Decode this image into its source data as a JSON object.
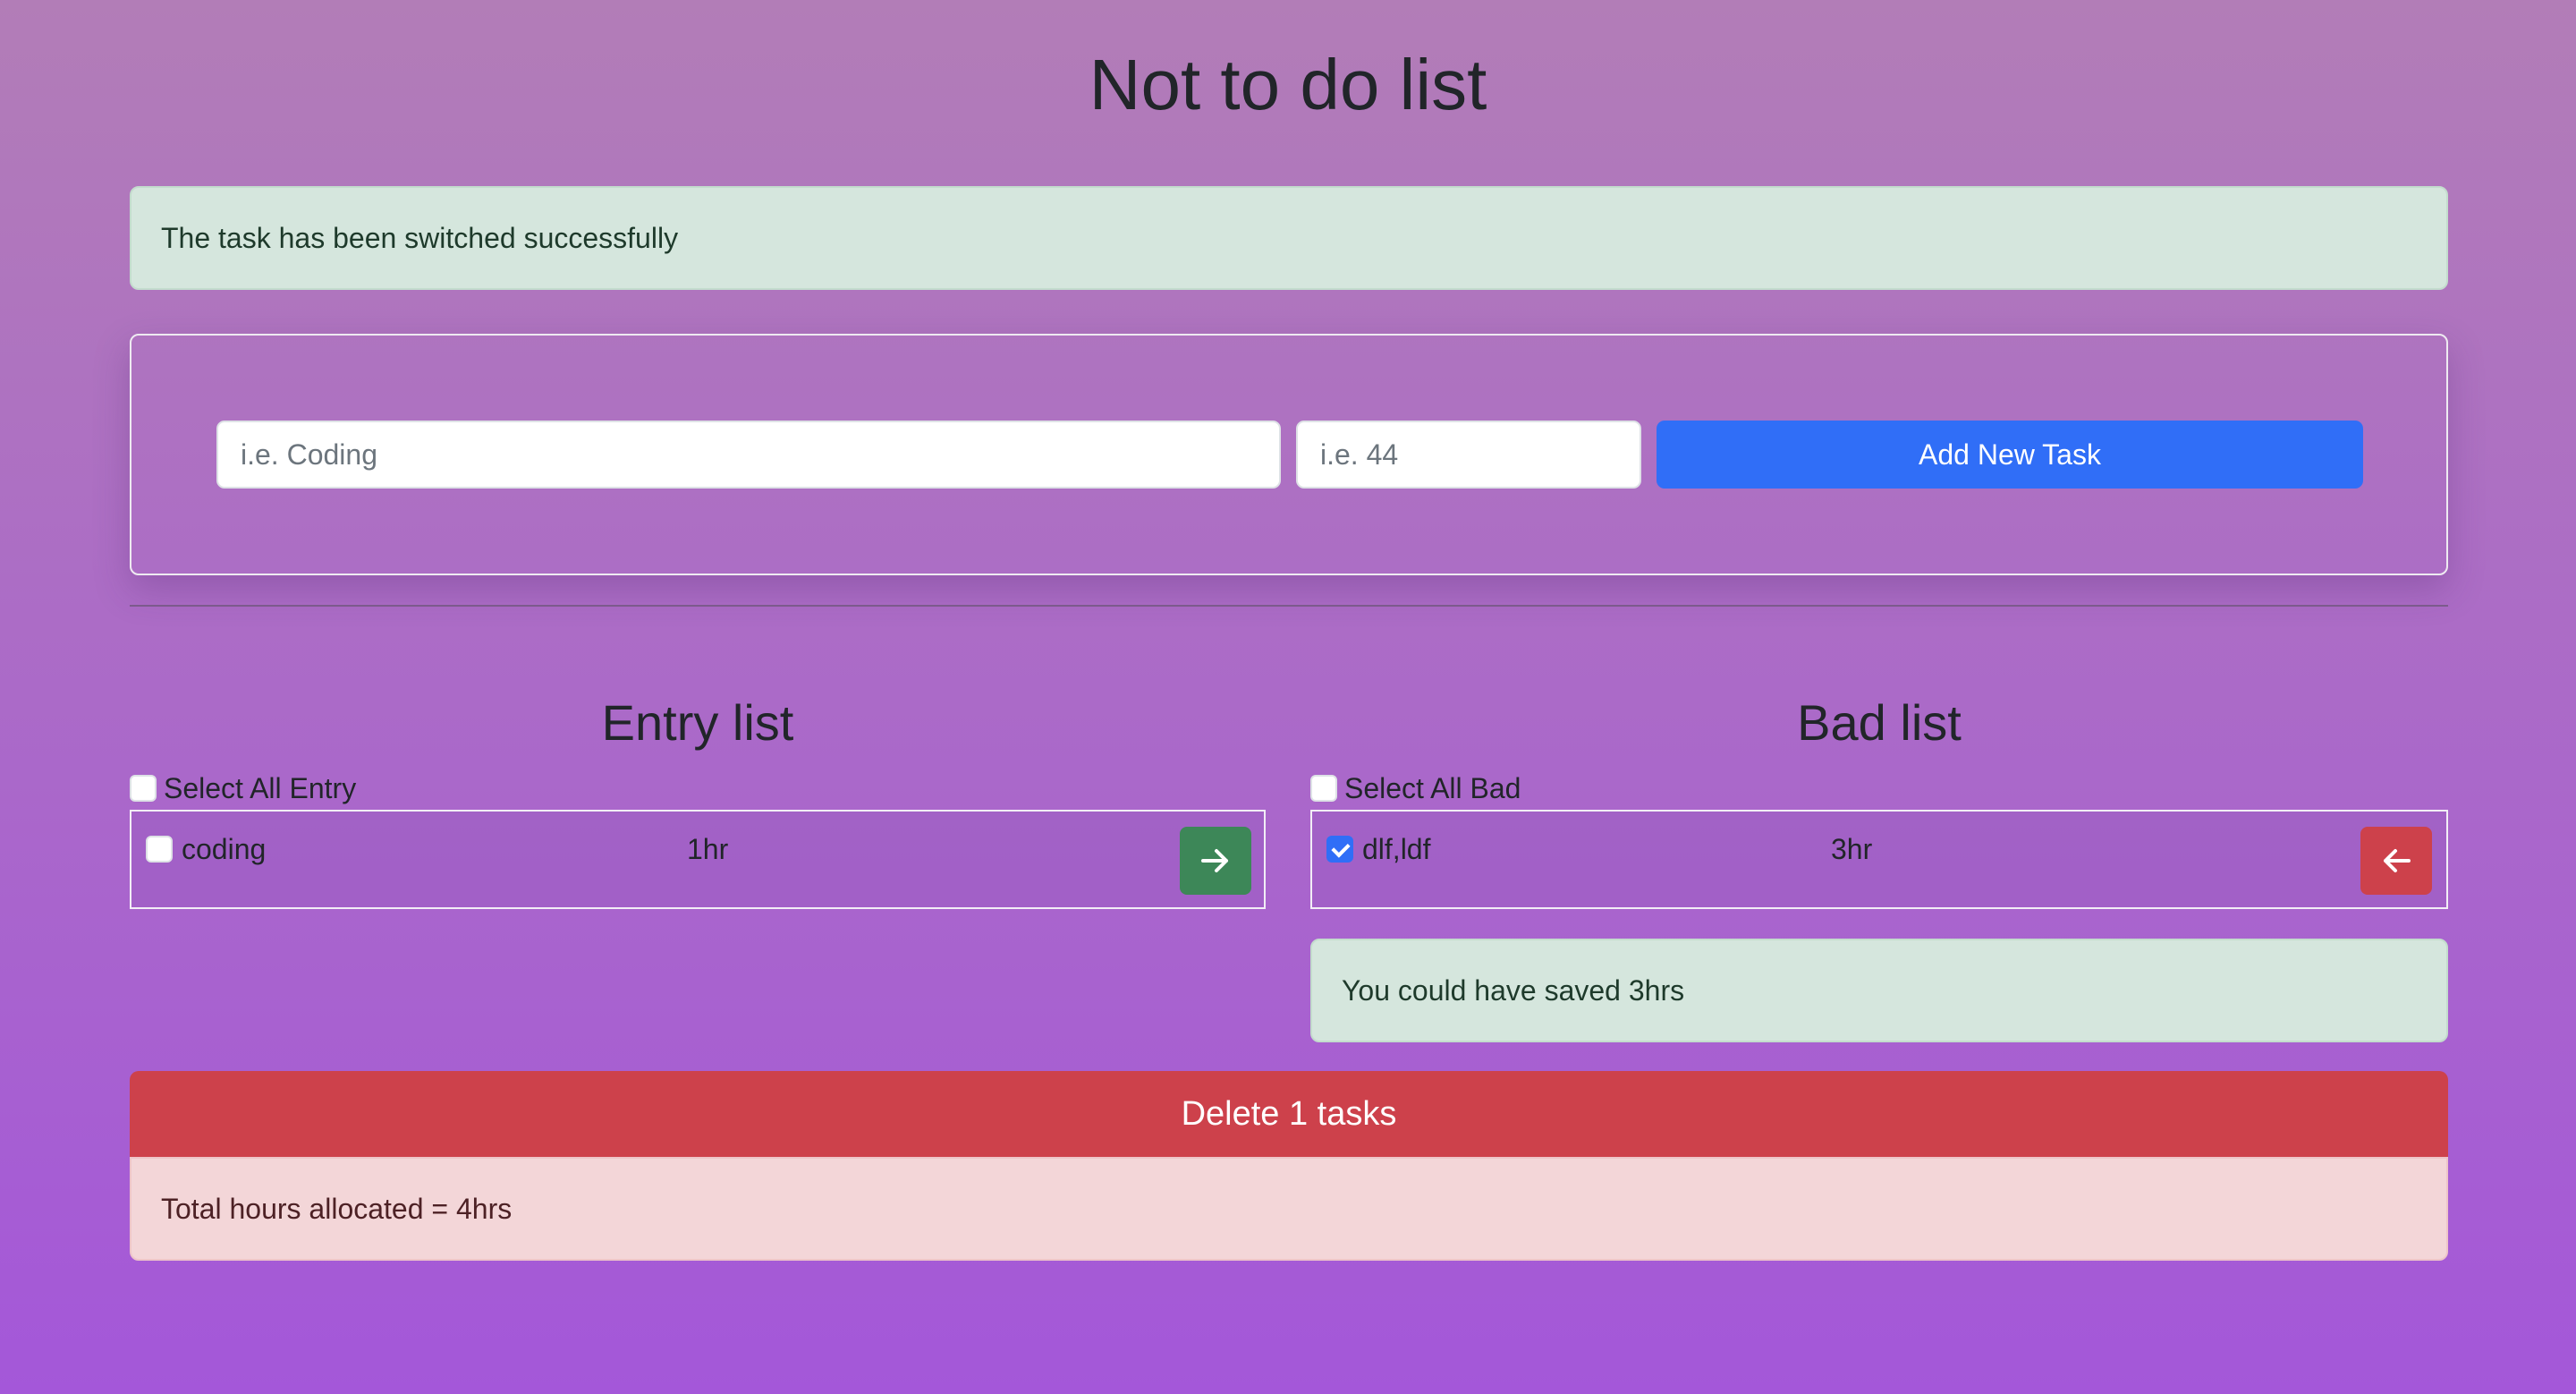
{
  "app": {
    "title": "Not to do list"
  },
  "status_message": "The task has been switched successfully",
  "form": {
    "task_placeholder": "i.e. Coding",
    "hours_placeholder": "i.e. 44",
    "submit_label": "Add New Task"
  },
  "entry_list": {
    "title": "Entry list",
    "select_all_label": "Select All Entry",
    "items": [
      {
        "name": "coding",
        "hours": "1hr",
        "checked": false
      }
    ]
  },
  "bad_list": {
    "title": "Bad list",
    "select_all_label": "Select All Bad",
    "items": [
      {
        "name": "dlf,ldf",
        "hours": "3hr",
        "checked": true
      }
    ],
    "saved_message": "You could have saved 3hrs"
  },
  "delete_button_label": "Delete 1 tasks",
  "total_hours_message": "Total hours allocated = 4hrs",
  "icons": {
    "move_to_bad": "arrow-right-icon",
    "move_to_entry": "arrow-left-icon"
  },
  "colors": {
    "primary": "#306ef7",
    "success": "#3d8758",
    "danger": "#cd414b",
    "alert_success_bg": "#d5e6dd",
    "alert_danger_bg": "#f3d6d8"
  }
}
